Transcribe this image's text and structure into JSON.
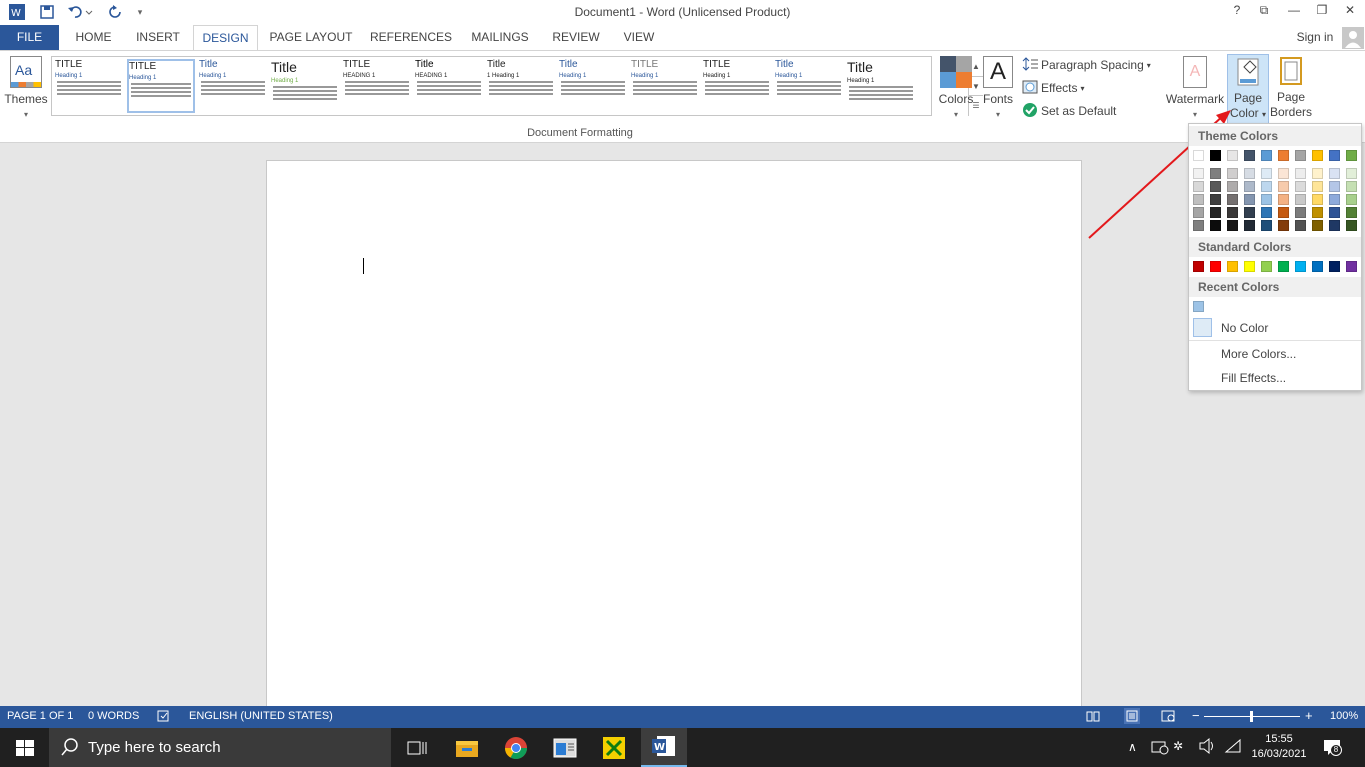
{
  "titlebar": {
    "title": "Document1 - Word (Unlicensed Product)",
    "help": "?",
    "controls": [
      "?",
      "⧉",
      "—",
      "❐",
      "✕"
    ]
  },
  "tabs": {
    "file": "FILE",
    "home": "HOME",
    "insert": "INSERT",
    "design": "DESIGN",
    "page_layout": "PAGE LAYOUT",
    "references": "REFERENCES",
    "mailings": "MAILINGS",
    "review": "REVIEW",
    "view": "VIEW",
    "sign_in": "Sign in"
  },
  "ribbon": {
    "themes": "Themes",
    "colors": "Colors",
    "fonts": "Fonts",
    "fonts_glyph": "A",
    "paragraph_spacing": "Paragraph Spacing",
    "effects": "Effects",
    "set_as_default": "Set as Default",
    "watermark": "Watermark",
    "page_color_1": "Page",
    "page_color_2": "Color",
    "page_borders_1": "Page",
    "page_borders_2": "Borders",
    "group_label": "Document Formatting",
    "gallery": [
      {
        "title": "TITLE",
        "heading": "Heading 1"
      },
      {
        "title": "TITLE",
        "heading": "Heading 1"
      },
      {
        "title": "Title",
        "heading": "Heading 1"
      },
      {
        "title": "Title",
        "heading": "Heading 1"
      },
      {
        "title": "TITLE",
        "heading": "HEADING 1"
      },
      {
        "title": "Title",
        "heading": "HEADING 1"
      },
      {
        "title": "Title",
        "heading": "1 Heading 1"
      },
      {
        "title": "Title",
        "heading": "Heading 1"
      },
      {
        "title": "TITLE",
        "heading": "Heading 1"
      },
      {
        "title": "TITLE",
        "heading": "Heading 1"
      },
      {
        "title": "Title",
        "heading": "Heading 1"
      },
      {
        "title": "Title",
        "heading": "Heading 1"
      }
    ]
  },
  "page_color_menu": {
    "theme_colors": "Theme Colors",
    "standard_colors": "Standard Colors",
    "recent_colors": "Recent Colors",
    "no_color": "No Color",
    "more_colors": "More Colors...",
    "fill_effects": "Fill Effects...",
    "theme_top_row": [
      "#ffffff",
      "#000000",
      "#e7e6e6",
      "#44546a",
      "#5b9bd5",
      "#ed7d31",
      "#a5a5a5",
      "#ffc000",
      "#4472c4",
      "#70ad47"
    ],
    "theme_shades": [
      [
        "#f2f2f2",
        "#7f7f7f",
        "#d0cece",
        "#d6dce4",
        "#deebf6",
        "#fbe5d5",
        "#ededed",
        "#fff2cc",
        "#d9e2f3",
        "#e2efd9"
      ],
      [
        "#d8d8d8",
        "#595959",
        "#aeabab",
        "#adb9ca",
        "#bdd7ee",
        "#f7cbac",
        "#dbdbdb",
        "#fee599",
        "#b4c6e7",
        "#c5e0b3"
      ],
      [
        "#bfbfbf",
        "#3f3f3f",
        "#757070",
        "#8496b0",
        "#9cc3e5",
        "#f4b183",
        "#c9c9c9",
        "#ffd965",
        "#8eaadb",
        "#a8d08d"
      ],
      [
        "#a5a5a5",
        "#262626",
        "#3a3838",
        "#323f4f",
        "#2e75b5",
        "#c55a11",
        "#7b7b7b",
        "#bf9000",
        "#2f5496",
        "#538135"
      ],
      [
        "#7f7f7f",
        "#0c0c0c",
        "#171616",
        "#222a35",
        "#1e4e79",
        "#833c0b",
        "#525252",
        "#7f6000",
        "#1f3864",
        "#375623"
      ]
    ],
    "standard": [
      "#c00000",
      "#ff0000",
      "#ffc000",
      "#ffff00",
      "#92d050",
      "#00b050",
      "#00b0f0",
      "#0070c0",
      "#002060",
      "#7030a0"
    ],
    "recent": [
      "#9dc3e6"
    ]
  },
  "status": {
    "page": "PAGE 1 OF 1",
    "words": "0 WORDS",
    "language": "ENGLISH (UNITED STATES)",
    "zoom": "100%"
  },
  "taskbar": {
    "search_placeholder": "Type here to search",
    "time": "15:55",
    "date": "16/03/2021",
    "notifications": "8"
  }
}
